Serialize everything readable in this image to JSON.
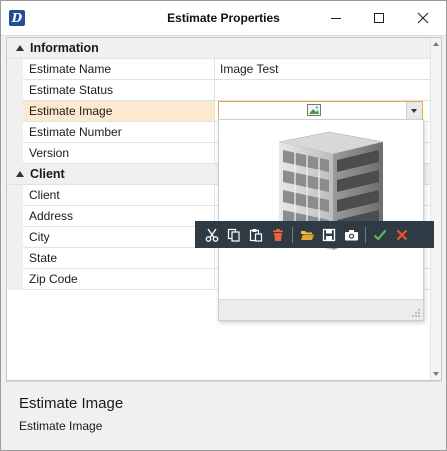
{
  "window": {
    "title": "Estimate Properties",
    "app_icon_letter": "D"
  },
  "grid": {
    "categories": [
      {
        "label": "Information",
        "rows": [
          {
            "name": "Estimate Name",
            "value": "Image Test"
          },
          {
            "name": "Estimate Status",
            "value": ""
          },
          {
            "name": "Estimate Image",
            "value": "",
            "selected": true
          },
          {
            "name": "Estimate Number",
            "value": ""
          },
          {
            "name": "Version",
            "value": ""
          }
        ]
      },
      {
        "label": "Client",
        "rows": [
          {
            "name": "Client",
            "value": ""
          },
          {
            "name": "Address",
            "value": ""
          },
          {
            "name": "City",
            "value": ""
          },
          {
            "name": "State",
            "value": ""
          },
          {
            "name": "Zip Code",
            "value": ""
          }
        ]
      }
    ]
  },
  "image_editor": {
    "value_icon": "image-icon",
    "toolbar": [
      "cut-icon",
      "copy-icon",
      "paste-icon",
      "delete-icon",
      "open-folder-icon",
      "save-icon",
      "camera-icon",
      "accept-icon",
      "cancel-icon"
    ]
  },
  "description": {
    "title": "Estimate Image",
    "text": "Estimate Image"
  },
  "colors": {
    "selected_row": "#fde9cf",
    "editor_border": "#e6a548",
    "toolbar_bg": "#2f3b44",
    "delete_icon": "#e8643c",
    "accept_icon": "#5cb85c",
    "cancel_icon": "#f0502c"
  }
}
